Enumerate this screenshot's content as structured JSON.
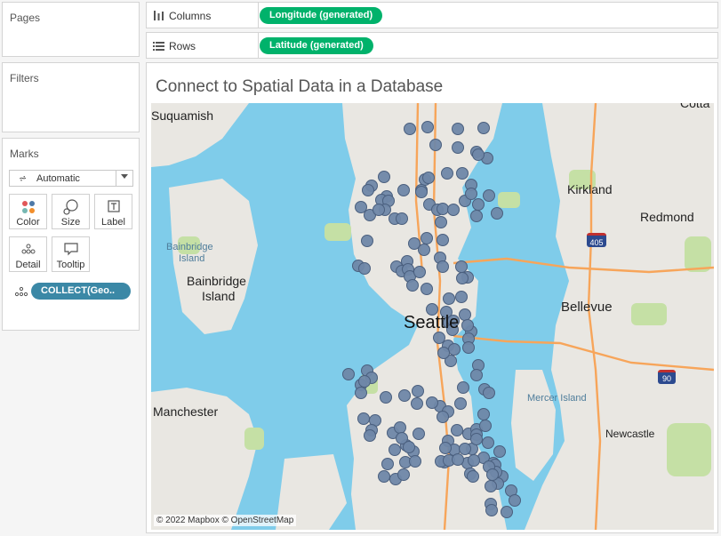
{
  "pages": {
    "title": "Pages"
  },
  "filters": {
    "title": "Filters"
  },
  "marks": {
    "title": "Marks",
    "mark_type": "Automatic",
    "cards": {
      "color": "Color",
      "size": "Size",
      "label": "Label",
      "detail": "Detail",
      "tooltip": "Tooltip"
    },
    "field": "COLLECT(Geo.."
  },
  "columns": {
    "label": "Columns",
    "pill": "Longitude (generated)"
  },
  "rows": {
    "label": "Rows",
    "pill": "Latitude (generated)"
  },
  "viz": {
    "title": "Connect to Spatial Data in a Database"
  },
  "map": {
    "labels": {
      "suquamish": "Suquamish",
      "kirkland": "Kirkland",
      "redmond": "Redmond",
      "bainbridge_small": "Bainbridge",
      "island_small": "Island",
      "bainbridge": "Bainbridge",
      "island": "Island",
      "seattle": "Seattle",
      "bellevue": "Bellevue",
      "mercer_island": "Mercer Island",
      "manchester": "Manchester",
      "newcastle": "Newcastle",
      "cotta": "Cotta",
      "shield_405": "405",
      "shield_90": "90"
    },
    "attribution": "© 2022 Mapbox © OpenStreetMap",
    "colors": {
      "water": "#7fccea",
      "land": "#e9e7e2",
      "park": "#c5e0a5",
      "highway": "#f7a55a",
      "mark": "#6f87a8"
    }
  }
}
